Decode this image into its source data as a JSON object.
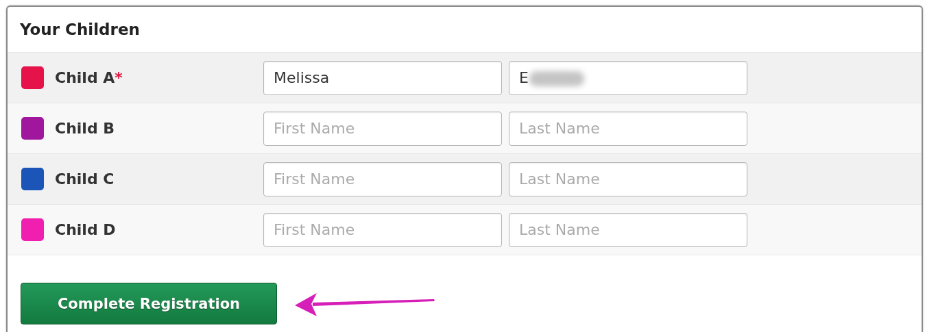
{
  "panel": {
    "title": "Your Children"
  },
  "children": [
    {
      "label": "Child A",
      "color": "#e5134a",
      "required": true,
      "first_name": {
        "value": "Melissa"
      },
      "last_name": {
        "value": "E",
        "redacted": true
      }
    },
    {
      "label": "Child B",
      "color": "#a0179e",
      "required": false,
      "first_name": {
        "placeholder": "First Name"
      },
      "last_name": {
        "placeholder": "Last Name",
        "redacted": false
      }
    },
    {
      "label": "Child C",
      "color": "#1b55b8",
      "required": false,
      "first_name": {
        "placeholder": "First Name"
      },
      "last_name": {
        "placeholder": "Last Name",
        "redacted": false
      }
    },
    {
      "label": "Child D",
      "color": "#f01fb0",
      "required": false,
      "first_name": {
        "placeholder": "First Name"
      },
      "last_name": {
        "placeholder": "Last Name",
        "redacted": false
      }
    }
  ],
  "required_mark": "*",
  "submit_button": {
    "label": "Complete Registration"
  }
}
